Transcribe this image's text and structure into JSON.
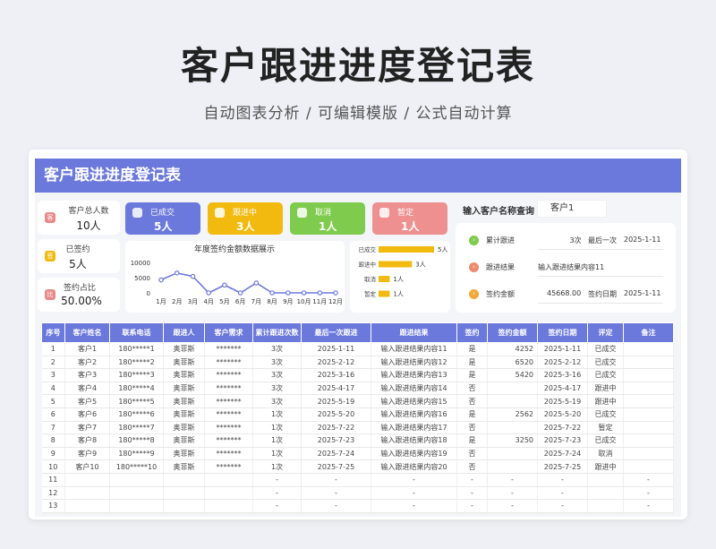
{
  "hero": {
    "title": "客户跟进进度登记表",
    "subtitle": "自动图表分析 / 可编辑模版 / 公式自动计算"
  },
  "banner_title": "客户跟进进度登记表",
  "stats": [
    {
      "label": "客户总人数",
      "value": "10人",
      "color": "#e98a8a"
    },
    {
      "label": "已签约",
      "value": "5人",
      "color": "#f2b90f"
    },
    {
      "label": "签约占比",
      "value": "50.00%",
      "color": "#e98a8a"
    }
  ],
  "kpis": [
    {
      "label": "已成交",
      "value": "5人",
      "color": "#6b78dc"
    },
    {
      "label": "跟进中",
      "value": "3人",
      "color": "#f2b90f"
    },
    {
      "label": "取消",
      "value": "1人",
      "color": "#7fcb4e"
    },
    {
      "label": "暂定",
      "value": "1人",
      "color": "#ee9090"
    }
  ],
  "chart_data": [
    {
      "type": "line",
      "title": "年度签约金额数据展示",
      "categories": [
        "1月",
        "2月",
        "3月",
        "4月",
        "5月",
        "6月",
        "7月",
        "8月",
        "9月",
        "10月",
        "11月",
        "12月"
      ],
      "values": [
        4252,
        6520,
        5420,
        0,
        2562,
        0,
        3250,
        0,
        0,
        0,
        0,
        0
      ],
      "yticks": [
        "10000",
        "5000",
        "0"
      ],
      "ylim": [
        0,
        10000
      ],
      "color": "#6b78dc"
    },
    {
      "type": "bar",
      "orientation": "horizontal",
      "categories": [
        "已成交",
        "跟进中",
        "取消",
        "暂定"
      ],
      "values": [
        5,
        3,
        1,
        1
      ],
      "labels": [
        "5人",
        "3人",
        "1人",
        "1人"
      ],
      "xlim": [
        0,
        5
      ],
      "color": "#f2b90f"
    }
  ],
  "query": {
    "label": "输入客户名称查询",
    "value": "客户1",
    "rows": [
      {
        "label": "累计跟进",
        "value": "3次",
        "label2": "最后一次",
        "value2": "2025-1-11",
        "color": "#7fcb4e"
      },
      {
        "label": "跟进结果",
        "value": "输入跟进结果内容11",
        "color": "#ee8a6e"
      },
      {
        "label": "签约金额",
        "value": "45668.00",
        "label2": "签约日期",
        "value2": "2025-1-11",
        "color": "#f2a93b"
      }
    ]
  },
  "table": {
    "headers": [
      "序号",
      "客户姓名",
      "联系电话",
      "跟进人",
      "客户需求",
      "累计跟进次数",
      "最后一次跟进",
      "跟进结果",
      "签约",
      "签约金额",
      "签约日期",
      "评定",
      "备注"
    ],
    "rows": [
      [
        "1",
        "客户1",
        "180*****1",
        "奥菲斯",
        "*******",
        "3次",
        "2025-1-11",
        "输入跟进结果内容11",
        "是",
        "4252",
        "2025-1-11",
        "已成交",
        ""
      ],
      [
        "2",
        "客户2",
        "180*****2",
        "奥菲斯",
        "*******",
        "3次",
        "2025-2-12",
        "输入跟进结果内容12",
        "是",
        "6520",
        "2025-2-12",
        "已成交",
        ""
      ],
      [
        "3",
        "客户3",
        "180*****3",
        "奥菲斯",
        "*******",
        "3次",
        "2025-3-16",
        "输入跟进结果内容13",
        "是",
        "5420",
        "2025-3-16",
        "已成交",
        ""
      ],
      [
        "4",
        "客户4",
        "180*****4",
        "奥菲斯",
        "*******",
        "3次",
        "2025-4-17",
        "输入跟进结果内容14",
        "否",
        "",
        "2025-4-17",
        "跟进中",
        ""
      ],
      [
        "5",
        "客户5",
        "180*****5",
        "奥菲斯",
        "*******",
        "3次",
        "2025-5-19",
        "输入跟进结果内容15",
        "否",
        "",
        "2025-5-19",
        "跟进中",
        ""
      ],
      [
        "6",
        "客户6",
        "180*****6",
        "奥菲斯",
        "*******",
        "1次",
        "2025-5-20",
        "输入跟进结果内容16",
        "是",
        "2562",
        "2025-5-20",
        "已成交",
        ""
      ],
      [
        "7",
        "客户7",
        "180*****7",
        "奥菲斯",
        "*******",
        "1次",
        "2025-7-22",
        "输入跟进结果内容17",
        "否",
        "",
        "2025-7-22",
        "暂定",
        ""
      ],
      [
        "8",
        "客户8",
        "180*****8",
        "奥菲斯",
        "*******",
        "1次",
        "2025-7-23",
        "输入跟进结果内容18",
        "是",
        "3250",
        "2025-7-23",
        "已成交",
        ""
      ],
      [
        "9",
        "客户9",
        "180*****9",
        "奥菲斯",
        "*******",
        "1次",
        "2025-7-24",
        "输入跟进结果内容19",
        "否",
        "",
        "2025-7-24",
        "取消",
        ""
      ],
      [
        "10",
        "客户10",
        "180*****10",
        "奥菲斯",
        "*******",
        "1次",
        "2025-7-25",
        "输入跟进结果内容20",
        "否",
        "",
        "2025-7-25",
        "跟进中",
        ""
      ],
      [
        "11",
        "",
        "",
        "",
        "",
        "-",
        "-",
        "-",
        "-",
        "-",
        "-",
        "",
        "-"
      ],
      [
        "12",
        "",
        "",
        "",
        "",
        "-",
        "-",
        "-",
        "-",
        "-",
        "-",
        "",
        "-"
      ],
      [
        "13",
        "",
        "",
        "",
        "",
        "-",
        "-",
        "-",
        "-",
        "-",
        "-",
        "",
        "-"
      ]
    ]
  }
}
